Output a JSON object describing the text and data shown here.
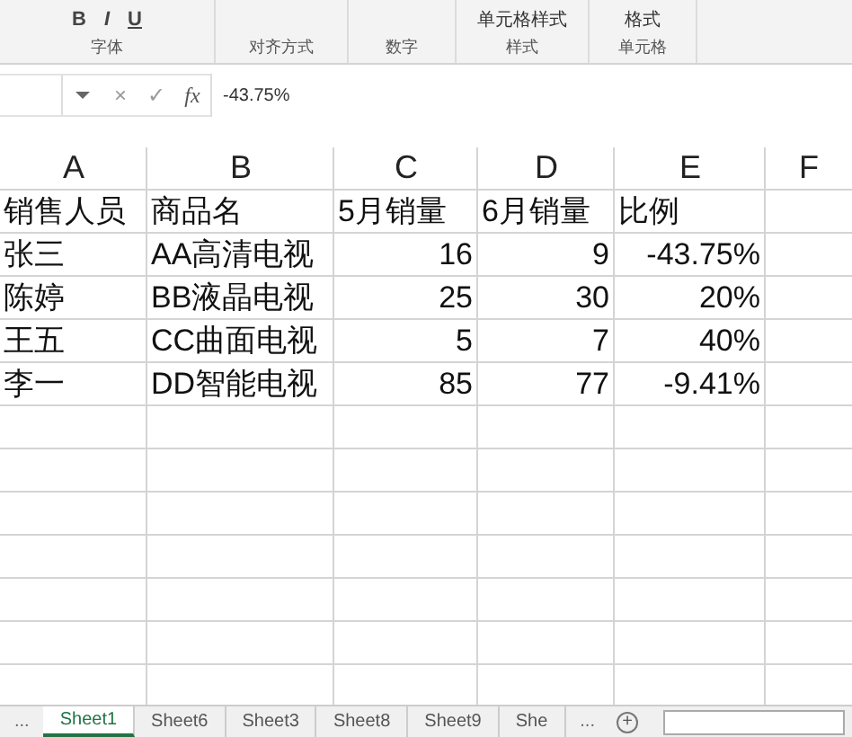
{
  "ribbon": {
    "groups": [
      {
        "label": "字体",
        "buttons": [
          "B",
          "I",
          "U"
        ]
      },
      {
        "label": "对齐方式"
      },
      {
        "label": "数字"
      },
      {
        "label": "样式",
        "items": [
          "单元格样式"
        ]
      },
      {
        "label": "单元格",
        "items": [
          "格式"
        ]
      }
    ]
  },
  "formula_bar": {
    "cancel": "×",
    "enter": "✓",
    "fx": "fx",
    "value": "-43.75%"
  },
  "columns": [
    "A",
    "B",
    "C",
    "D",
    "E",
    "F"
  ],
  "rows": [
    [
      "销售人员",
      "商品名",
      "5月销量",
      "6月销量",
      "比例"
    ],
    [
      "张三",
      "AA高清电视",
      "16",
      "9",
      "-43.75%"
    ],
    [
      "陈婷",
      "BB液晶电视",
      "25",
      "30",
      "20%"
    ],
    [
      "王五",
      "CC曲面电视",
      "5",
      "7",
      "40%"
    ],
    [
      "李一",
      "DD智能电视",
      "85",
      "77",
      "-9.41%"
    ]
  ],
  "sheet_tabs": {
    "more_left": "...",
    "tabs": [
      {
        "label": "Sheet1",
        "selected": true
      },
      {
        "label": "Sheet6",
        "selected": false
      },
      {
        "label": "Sheet3",
        "selected": false
      },
      {
        "label": "Sheet8",
        "selected": false
      },
      {
        "label": "Sheet9",
        "selected": false
      },
      {
        "label": "She",
        "selected": false
      }
    ],
    "more_right": "...",
    "add": "+"
  }
}
